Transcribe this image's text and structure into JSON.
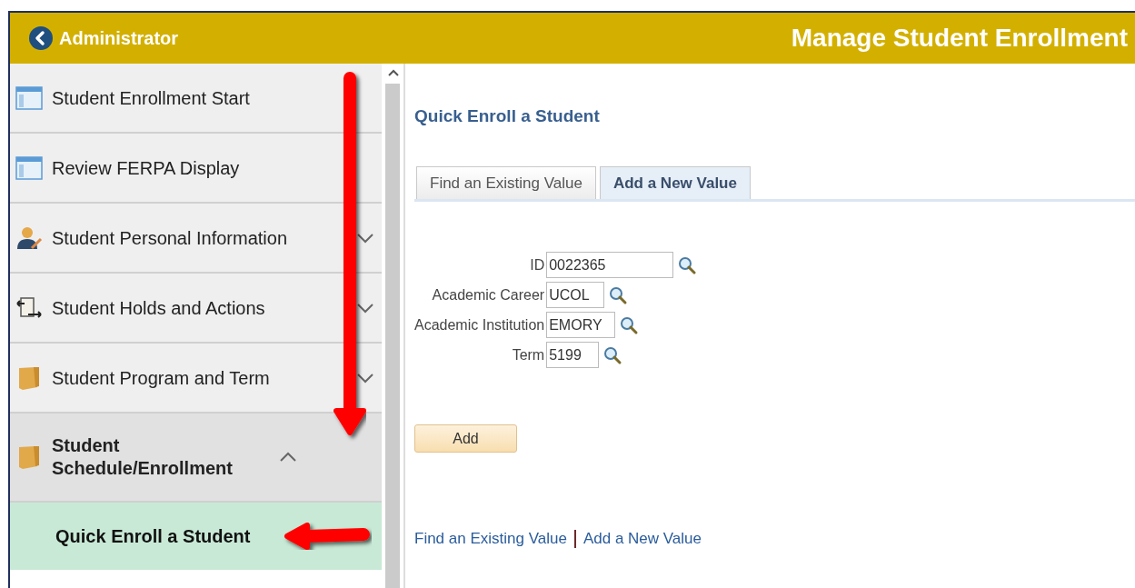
{
  "header": {
    "back_label": "Administrator",
    "title": "Manage Student Enrollment"
  },
  "sidebar": {
    "items": [
      {
        "kind": "page",
        "label": "Student Enrollment Start"
      },
      {
        "kind": "page",
        "label": "Review FERPA Display"
      },
      {
        "kind": "person",
        "label": "Student Personal Information",
        "expanded": false
      },
      {
        "kind": "actions",
        "label": "Student Holds and Actions",
        "expanded": false
      },
      {
        "kind": "folder",
        "label": "Student Program and Term",
        "expanded": false
      },
      {
        "kind": "folder",
        "label": "Student Schedule/Enrollment",
        "expanded": true,
        "children": [
          {
            "label": "Quick Enroll a Student",
            "selected": true
          }
        ]
      }
    ]
  },
  "page": {
    "title": "Quick Enroll a Student",
    "tabs": [
      {
        "label": "Find an Existing Value",
        "selected": false
      },
      {
        "label": "Add a New Value",
        "selected": true
      }
    ],
    "fields": [
      {
        "label": "ID",
        "value": "0022365"
      },
      {
        "label": "Academic Career",
        "value": "UCOL"
      },
      {
        "label": "Academic Institution",
        "value": "EMORY"
      },
      {
        "label": "Term",
        "value": "5199"
      }
    ],
    "add_button": "Add",
    "links": [
      "Find an Existing Value",
      "Add a New Value"
    ]
  }
}
